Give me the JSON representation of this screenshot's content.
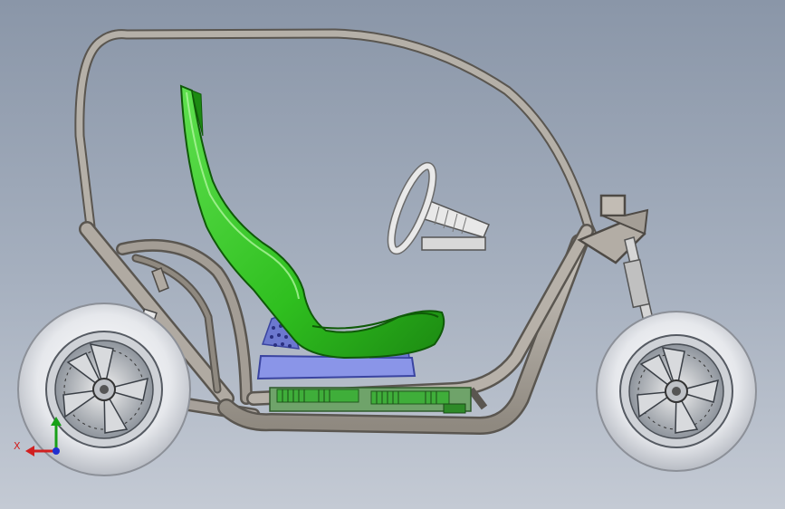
{
  "viewport": {
    "background_top": "#8a96a8",
    "background_bottom": "#c4cad4"
  },
  "model": {
    "parts": [
      "roof-frame",
      "main-chassis",
      "seat",
      "seat-base",
      "battery-pack",
      "steering-wheel",
      "steering-column",
      "rear-wheel",
      "front-wheel",
      "rear-suspension",
      "front-fork"
    ],
    "colors": {
      "frame": "#a7a19a",
      "seat": "#2fbf1f",
      "seat_base": "#8a95e8",
      "battery": "#3fae3a",
      "tire": "#e4e6ea",
      "rim": "#9aa0a8"
    }
  },
  "triad": {
    "x_label": "X",
    "x_color": "#d12020",
    "y_color": "#18a018",
    "z_color": "#2030d0"
  }
}
